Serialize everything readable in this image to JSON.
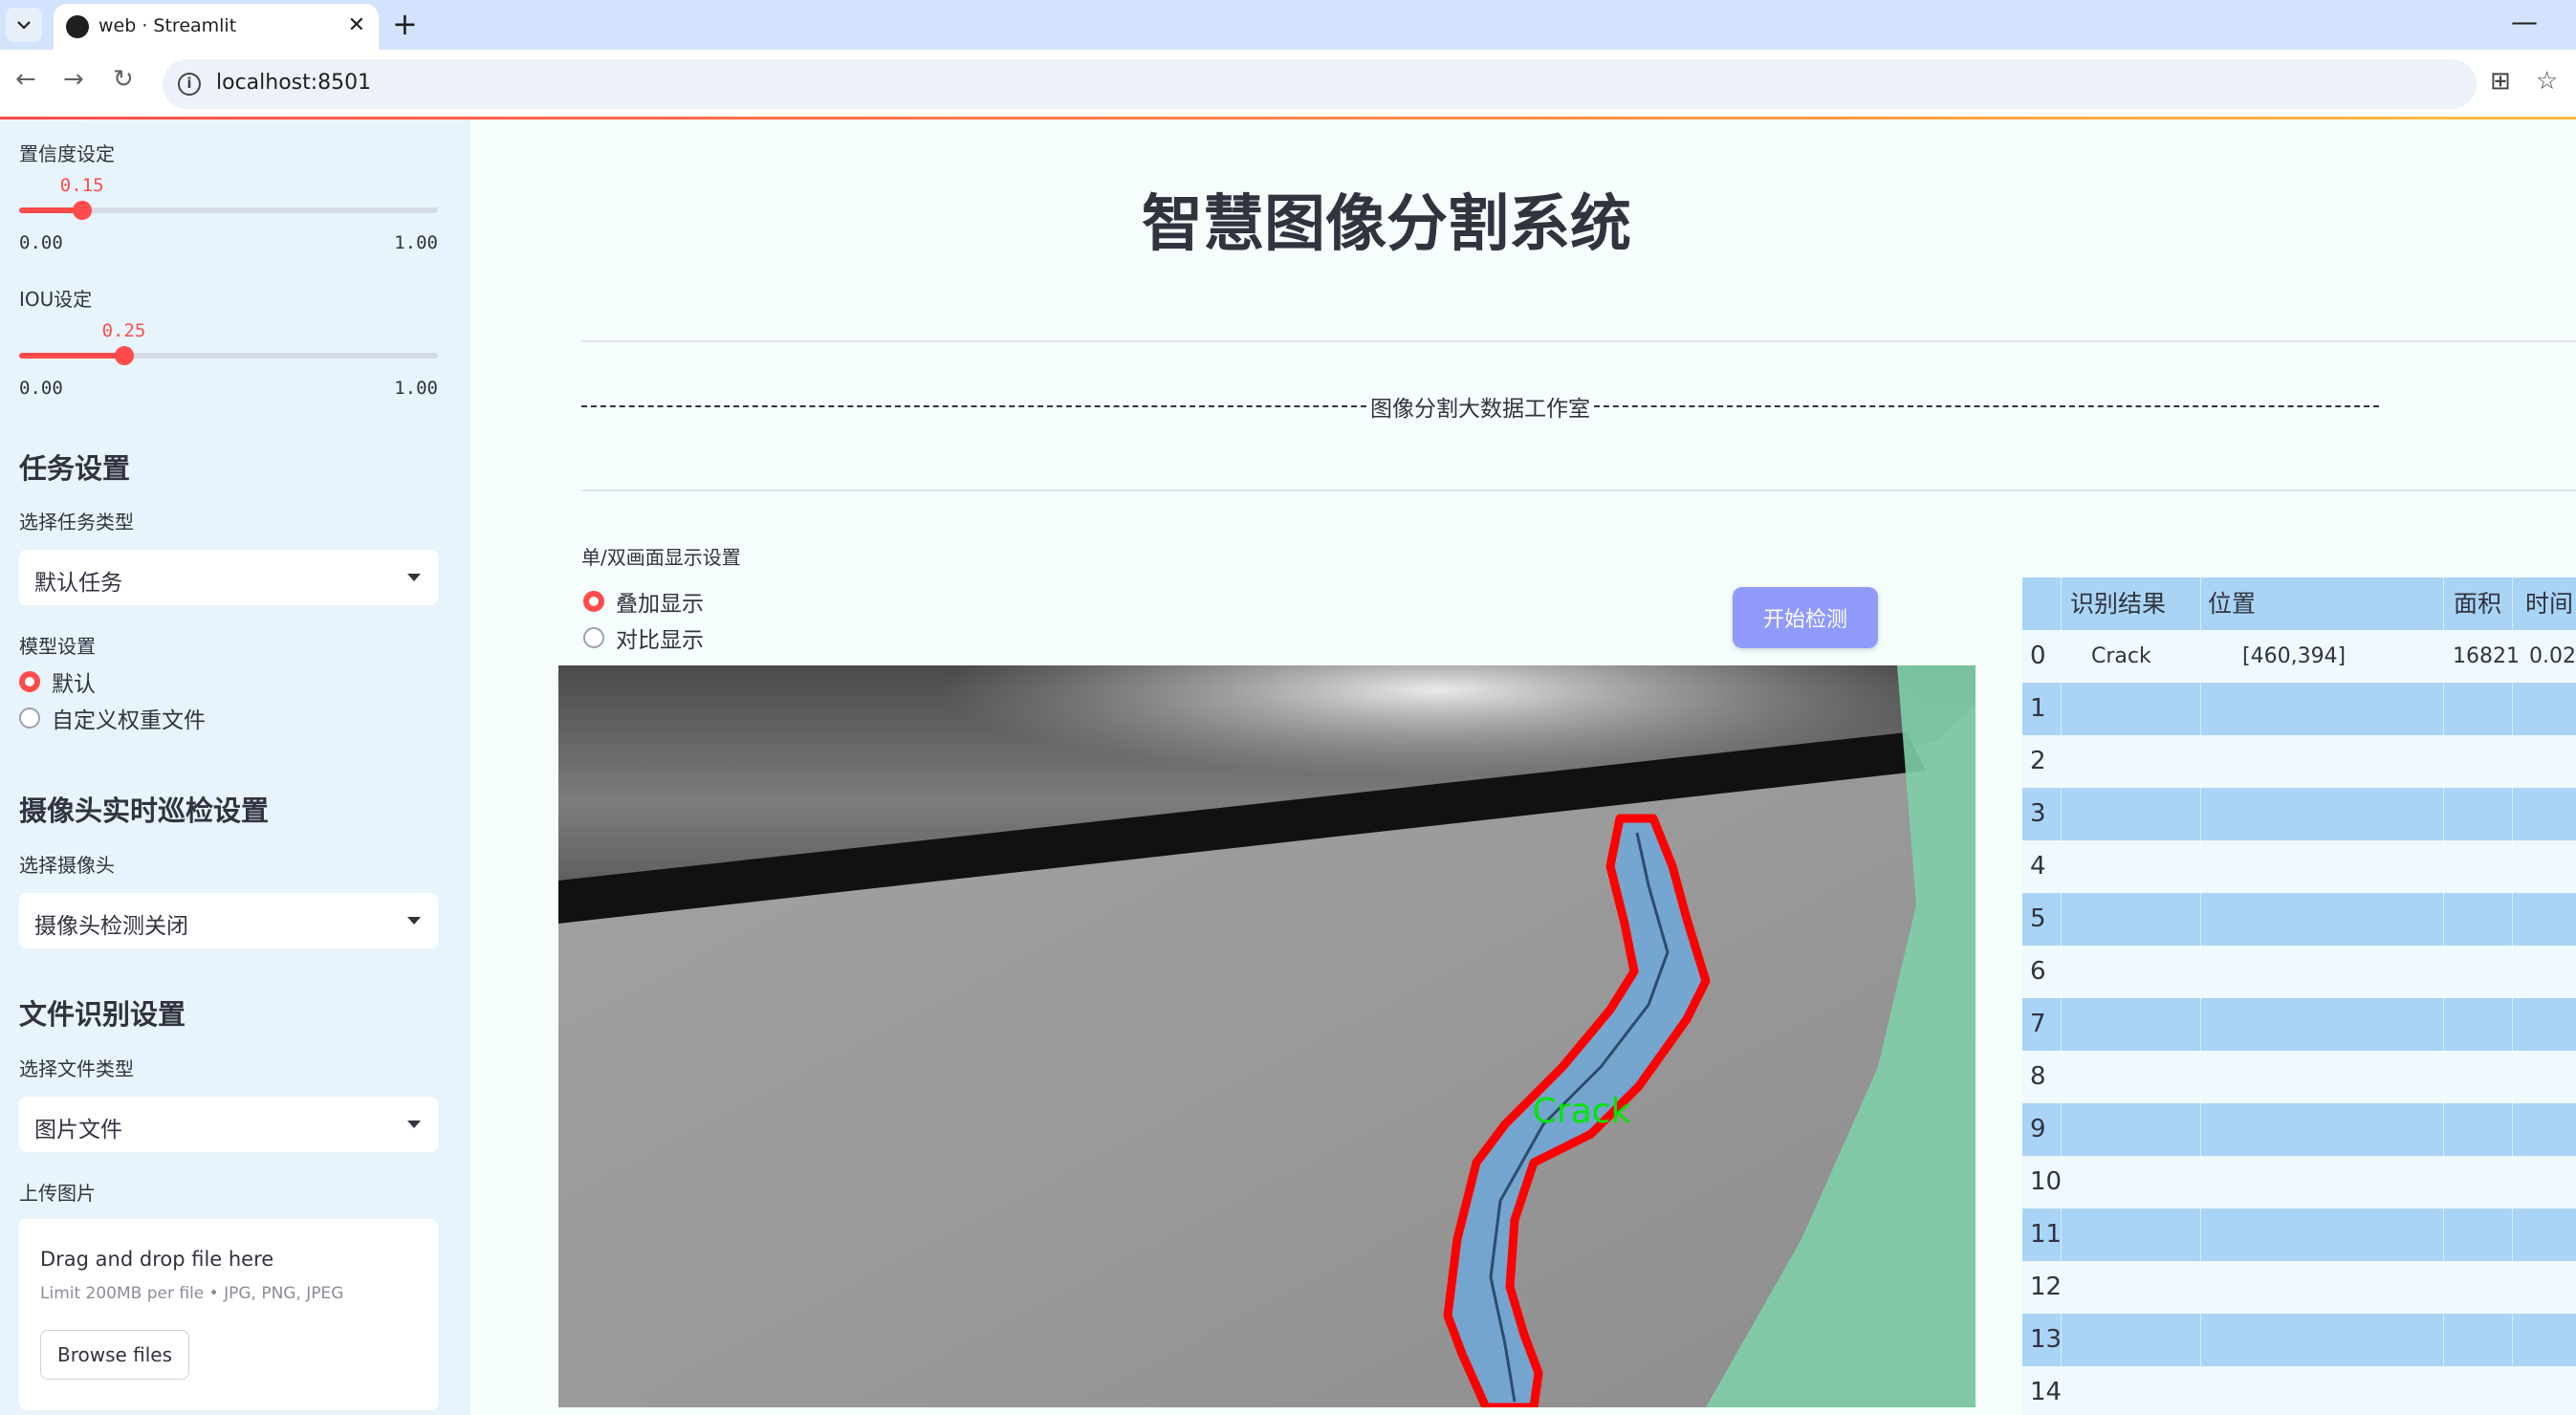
{
  "browser": {
    "tab_title": "web · Streamlit",
    "url": "localhost:8501"
  },
  "sidebar": {
    "confidence": {
      "label": "置信度设定",
      "value": "0.15",
      "min": "0.00",
      "max": "1.00",
      "fraction": 0.15
    },
    "iou": {
      "label": "IOU设定",
      "value": "0.25",
      "min": "0.00",
      "max": "1.00",
      "fraction": 0.25
    },
    "task_heading": "任务设置",
    "task_type_label": "选择任务类型",
    "task_type_value": "默认任务",
    "model_label": "模型设置",
    "model_options": [
      "默认",
      "自定义权重文件"
    ],
    "camera_heading": "摄像头实时巡检设置",
    "camera_label": "选择摄像头",
    "camera_value": "摄像头检测关闭",
    "file_heading": "文件识别设置",
    "file_type_label": "选择文件类型",
    "file_type_value": "图片文件",
    "upload_label": "上传图片",
    "upload_title": "Drag and drop file here",
    "upload_limit": "Limit 200MB per file • JPG, PNG, JPEG",
    "browse_label": "Browse files"
  },
  "main": {
    "title": "智慧图像分割系统",
    "studio": "图像分割大数据工作室",
    "display_label": "单/双画面显示设置",
    "display_options": [
      "叠加显示",
      "对比显示"
    ],
    "start_button": "开始检测",
    "detection_label": "Crack"
  },
  "table": {
    "headers": [
      "识别结果",
      "位置",
      "面积",
      "时间"
    ],
    "rows": [
      {
        "index": "0",
        "result": "Crack",
        "position": "[460,394]",
        "area": "16821",
        "time": "0.02"
      },
      {
        "index": "1"
      },
      {
        "index": "2"
      },
      {
        "index": "3"
      },
      {
        "index": "4"
      },
      {
        "index": "5"
      },
      {
        "index": "6"
      },
      {
        "index": "7"
      },
      {
        "index": "8"
      },
      {
        "index": "9"
      },
      {
        "index": "10"
      },
      {
        "index": "11"
      },
      {
        "index": "12"
      },
      {
        "index": "13"
      },
      {
        "index": "14"
      }
    ]
  },
  "colors": {
    "accent": "#ff4b4b",
    "sidebar_bg": "#e8f4fb",
    "button_bg": "#8f9afb",
    "table_header": "#a9d4f5",
    "mask_outline": "#ff0000",
    "mask_fill": "#6fa8d8",
    "label_green": "#00e600"
  }
}
